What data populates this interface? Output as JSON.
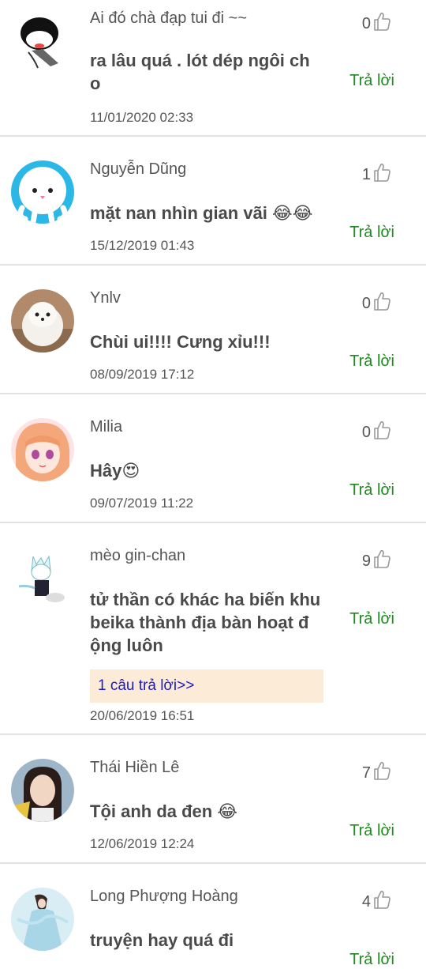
{
  "comments": [
    {
      "name": "Ai đó chà đạp tui đi ~~",
      "text_line1": "ra lâu quá . lót dép ngôi ch",
      "text_line2": "o",
      "time": "11/01/2020 02:33",
      "likes": "0",
      "reply": "Trả lời"
    },
    {
      "name": "Nguyễn Dũng",
      "text_line1": "mặt nan nhìn gian vãi 😂😂",
      "time": "15/12/2019 01:43",
      "likes": "1",
      "reply": "Trả lời"
    },
    {
      "name": "Ynlv",
      "text_line1": "Chùi ui!!!! Cưng xỉu!!!",
      "time": "08/09/2019 17:12",
      "likes": "0",
      "reply": "Trả lời"
    },
    {
      "name": "Milia",
      "text_line1": "Hây😍",
      "time": "09/07/2019 11:22",
      "likes": "0",
      "reply": "Trả lời"
    },
    {
      "name": "mèo gin-chan",
      "text_line1": "tử thần có khác ha biến khu",
      "text_line2": "beika thành địa bàn hoạt đ",
      "text_line3": "ộng luôn",
      "replies_link": "1 câu trả lời>>",
      "time": "20/06/2019 16:51",
      "likes": "9",
      "reply": "Trả lời"
    },
    {
      "name": "Thái Hiền Lê",
      "text_line1": "Tội anh da đen 😂",
      "time": "12/06/2019 12:24",
      "likes": "7",
      "reply": "Trả lời"
    },
    {
      "name": "Long Phượng Hoàng",
      "text_line1": "truyện hay quá đi",
      "likes": "4",
      "reply": "Trả lời"
    }
  ]
}
